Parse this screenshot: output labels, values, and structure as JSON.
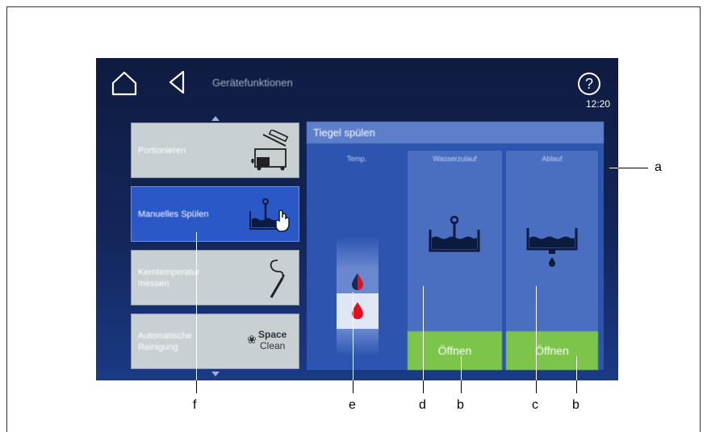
{
  "header": {
    "title": "Gerätefunktionen",
    "time": "12:20",
    "help_glyph": "?"
  },
  "sidebar": {
    "items": [
      {
        "label": "Portionieren",
        "icon": "portioning-icon"
      },
      {
        "label": "Manuelles Spülen",
        "icon": "manual-rinse-icon"
      },
      {
        "label": "Kerntemperatur messen",
        "icon": "core-probe-icon"
      },
      {
        "label": "Automatische Reinigung",
        "icon": "spaceclean-icon",
        "logo_line1": "Space",
        "logo_line2": "Clean"
      }
    ]
  },
  "panel": {
    "title": "Tiegel spülen",
    "columns": {
      "temp": {
        "label": "Temp."
      },
      "water_inlet": {
        "label": "Wasserzulauf",
        "button": "Öffnen"
      },
      "drain": {
        "label": "Ablauf",
        "button": "Öffnen"
      }
    }
  },
  "callouts": {
    "a": "a",
    "b1": "b",
    "b2": "b",
    "c": "c",
    "d": "d",
    "e": "e",
    "f": "f"
  },
  "colors": {
    "screen_bg": "#13265a",
    "active_item": "#2a58c6",
    "button_green": "#7dc44b",
    "drop_red": "#e3101d"
  }
}
